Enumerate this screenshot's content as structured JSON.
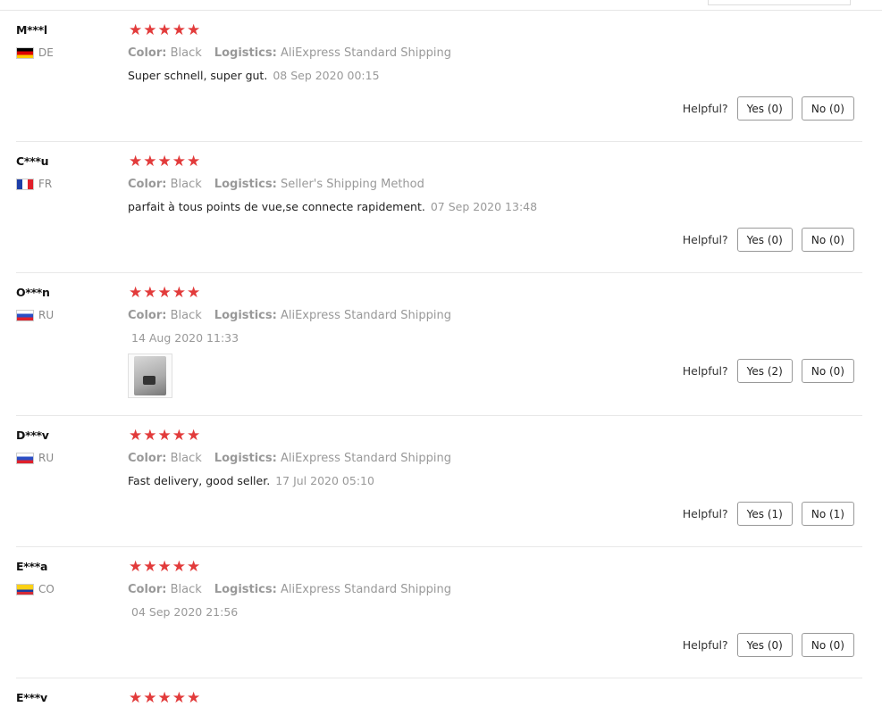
{
  "labels": {
    "color": "Color:",
    "logistics": "Logistics:",
    "helpful": "Helpful?"
  },
  "stars": "★★★★★",
  "reviews": [
    {
      "name": "M***l",
      "country": "DE",
      "flag": "flag-de",
      "color": "Black",
      "logistics": "AliExpress Standard Shipping",
      "text": "Super schnell, super gut.",
      "date": "08 Sep 2020 00:15",
      "yes": "Yes (0)",
      "no": "No (0)"
    },
    {
      "name": "C***u",
      "country": "FR",
      "flag": "flag-fr",
      "color": "Black",
      "logistics": "Seller's Shipping Method",
      "text": "parfait à tous points de vue,se connecte rapidement.",
      "date": "07 Sep 2020 13:48",
      "yes": "Yes (0)",
      "no": "No (0)"
    },
    {
      "name": "O***n",
      "country": "RU",
      "flag": "flag-ru",
      "color": "Black",
      "logistics": "AliExpress Standard Shipping",
      "text": "",
      "date": "14 Aug 2020 11:33",
      "yes": "Yes (2)",
      "no": "No (0)"
    },
    {
      "name": "D***v",
      "country": "RU",
      "flag": "flag-ru",
      "color": "Black",
      "logistics": "AliExpress Standard Shipping",
      "text": "Fast delivery, good seller.",
      "date": "17 Jul 2020 05:10",
      "yes": "Yes (1)",
      "no": "No (1)"
    },
    {
      "name": "E***a",
      "country": "CO",
      "flag": "flag-co",
      "color": "Black",
      "logistics": "AliExpress Standard Shipping",
      "text": "",
      "date": "04 Sep 2020 21:56",
      "yes": "Yes (0)",
      "no": "No (0)"
    },
    {
      "name": "E***v"
    }
  ]
}
